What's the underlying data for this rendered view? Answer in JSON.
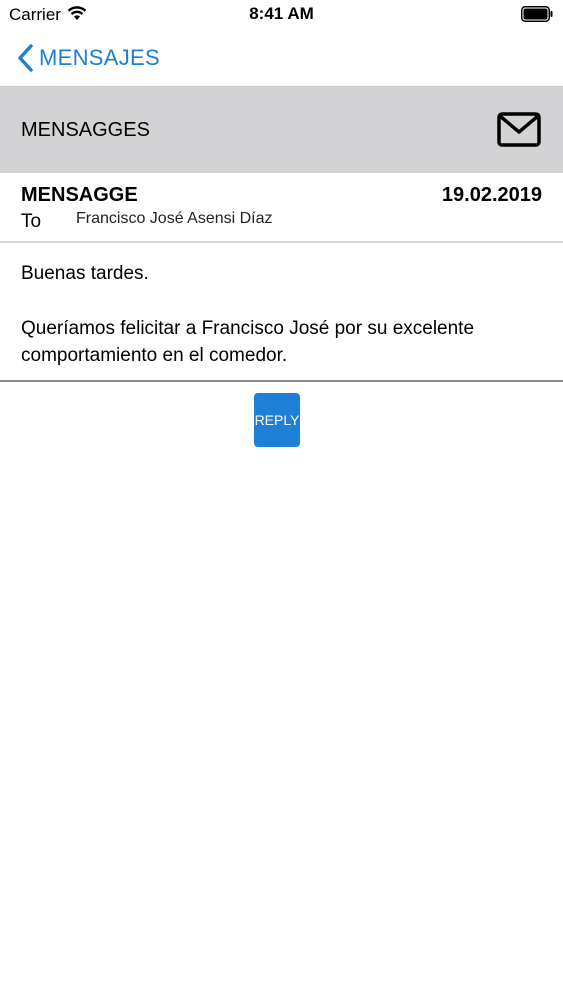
{
  "status_bar": {
    "carrier": "Carrier",
    "time": "8:41 AM",
    "wifi_icon": "wifi-icon",
    "battery_icon": "battery-icon"
  },
  "nav": {
    "back_label": "MENSAJES",
    "back_icon": "chevron-left-icon",
    "accent_color": "#1d7fd6"
  },
  "section": {
    "title": "MENSAGGES",
    "icon": "mail-icon",
    "background": "#d3d3d6"
  },
  "message": {
    "title": "MENSAGGE",
    "date": "19.02.2019",
    "to_label": "To",
    "to_name": "Francisco José Asensi Díaz",
    "greeting": "Buenas tardes.",
    "body": "Queríamos felicitar a Francisco José por su excelente comportamiento en el comedor."
  },
  "actions": {
    "reply_label": "REPLY"
  }
}
